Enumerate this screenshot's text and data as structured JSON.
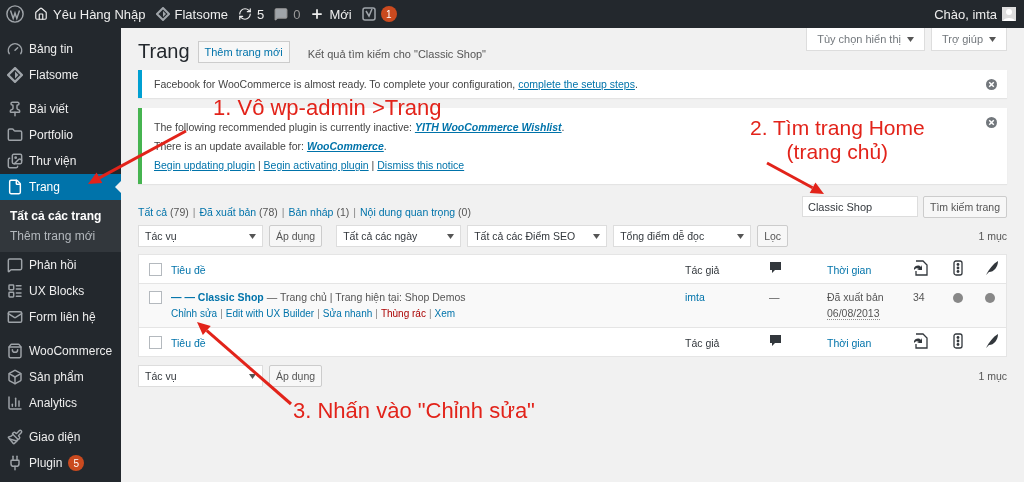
{
  "admin_bar": {
    "site": "Yêu Hàng Nhập",
    "theme": "Flatsome",
    "updates": "5",
    "comments": "0",
    "new": "Mới",
    "seo_badge": "1",
    "greeting": "Chào, imta"
  },
  "sidebar": {
    "groups": [
      [
        {
          "label": "Bảng tin",
          "selected": false
        },
        {
          "label": "Flatsome",
          "selected": false
        }
      ],
      [
        {
          "label": "Bài viết",
          "selected": false
        },
        {
          "label": "Portfolio",
          "selected": false
        },
        {
          "label": "Thư viện",
          "selected": false
        },
        {
          "label": "Trang",
          "selected": true,
          "children": [
            {
              "label": "Tất cả các trang",
              "selected": true
            },
            {
              "label": "Thêm trang mới",
              "selected": false
            }
          ]
        },
        {
          "label": "Phản hồi",
          "selected": false
        },
        {
          "label": "UX Blocks",
          "selected": false
        },
        {
          "label": "Form liên hệ",
          "selected": false
        }
      ],
      [
        {
          "label": "WooCommerce",
          "selected": false
        },
        {
          "label": "Sản phẩm",
          "selected": false
        },
        {
          "label": "Analytics",
          "selected": false
        }
      ],
      [
        {
          "label": "Giao diện",
          "selected": false
        },
        {
          "label": "Plugin",
          "selected": false,
          "badge": "5"
        }
      ]
    ]
  },
  "screen_meta": [
    {
      "label": "Tùy chọn hiển thị"
    },
    {
      "label": "Trợ giúp"
    }
  ],
  "header": {
    "title": "Trang",
    "add_button": "Thêm trang mới",
    "subtitle": "Kết quả tìm kiếm cho \"Classic Shop\""
  },
  "notices": [
    {
      "kind": "info",
      "lines": [
        [
          {
            "kind": "text",
            "text": "Facebook for WooCommerce is almost ready. To complete your configuration, "
          },
          {
            "kind": "link",
            "text": "complete the setup steps"
          },
          {
            "kind": "text",
            "text": "."
          }
        ]
      ]
    },
    {
      "kind": "success",
      "lines": [
        [
          {
            "kind": "text",
            "text": "The following recommended plugin is currently inactive: "
          },
          {
            "kind": "strong-link",
            "text": "YITH WooCommerce Wishlist"
          },
          {
            "kind": "text",
            "text": "."
          }
        ],
        [
          {
            "kind": "text",
            "text": "There is an update available for: "
          },
          {
            "kind": "strong-link",
            "text": "WooCommerce"
          },
          {
            "kind": "text",
            "text": "."
          }
        ],
        [
          {
            "kind": "link",
            "text": "Begin updating plugin"
          },
          {
            "kind": "text",
            "text": " | "
          },
          {
            "kind": "link",
            "text": "Begin activating plugin"
          },
          {
            "kind": "text",
            "text": " | "
          },
          {
            "kind": "link",
            "text": "Dismiss this notice"
          }
        ]
      ]
    }
  ],
  "views": [
    {
      "label": "Tất cả",
      "count": "(79)",
      "selected": false
    },
    {
      "separator": "|",
      "label": "Đã xuất bản",
      "count": "(78)",
      "selected": false
    },
    {
      "separator": "|",
      "label": "Bản nháp",
      "count": "(1)",
      "selected": false
    },
    {
      "separator": "|",
      "label": "Nội dung quan trọng",
      "count": "(0)",
      "selected": false
    }
  ],
  "search": {
    "value": "Classic Shop",
    "button": "Tìm kiếm trang"
  },
  "top_filters": {
    "bulk": "Tác vụ",
    "apply": "Áp dụng",
    "selects": [
      "Tất cả các ngày",
      "Tất cả các Điểm SEO",
      "Tổng điểm dễ đọc"
    ],
    "filter": "Lọc",
    "count": "1 mục"
  },
  "table": {
    "header": {
      "checked": false,
      "columns": [
        {
          "kind": "title",
          "label": "Tiêu đề"
        },
        {
          "kind": "author",
          "label": "Tác giả"
        },
        {
          "kind": "comments"
        },
        {
          "kind": "date",
          "label": "Thời gian"
        },
        {
          "kind": "links"
        },
        {
          "kind": "seo"
        },
        {
          "kind": "readability"
        }
      ]
    },
    "rows": [
      {
        "checked": false,
        "title": "— — Classic Shop",
        "state": " — Trang chủ | Trang hiện tại: Shop Demos",
        "actions": [
          {
            "kind": "link",
            "label": "Chỉnh sửa"
          },
          {
            "kind": "link",
            "separator": "|",
            "label": "Edit with UX Builder"
          },
          {
            "kind": "link",
            "separator": "|",
            "label": "Sửa nhanh"
          },
          {
            "kind": "delete",
            "separator": "|",
            "label": "Thùng rác"
          },
          {
            "kind": "link",
            "separator": "|",
            "label": "Xem"
          }
        ],
        "author": "imta",
        "comments": "—",
        "status": "Đã xuất bản",
        "date": "06/08/2013",
        "links": "34",
        "seo": {
          "color": "#888888"
        },
        "readability": {
          "color": "#888888"
        }
      }
    ],
    "footer": {
      "checked": false,
      "columns": [
        {
          "kind": "title",
          "label": "Tiêu đề"
        },
        {
          "kind": "author",
          "label": "Tác giả"
        },
        {
          "kind": "comments"
        },
        {
          "kind": "date",
          "label": "Thời gian"
        },
        {
          "kind": "links"
        },
        {
          "kind": "seo"
        },
        {
          "kind": "readability"
        }
      ]
    }
  },
  "bottom_filters": {
    "bulk": "Tác vụ",
    "apply": "Áp dụng",
    "count": "1 mục"
  },
  "annotations": [
    {
      "lines": [
        "1. Vô wp-admin >Trang"
      ]
    },
    {
      "lines": [
        "2. Tìm trang Home",
        "(trang chủ)"
      ]
    },
    {
      "lines": [
        "3. Nhấn vào \"Chỉnh sửa\""
      ]
    }
  ]
}
